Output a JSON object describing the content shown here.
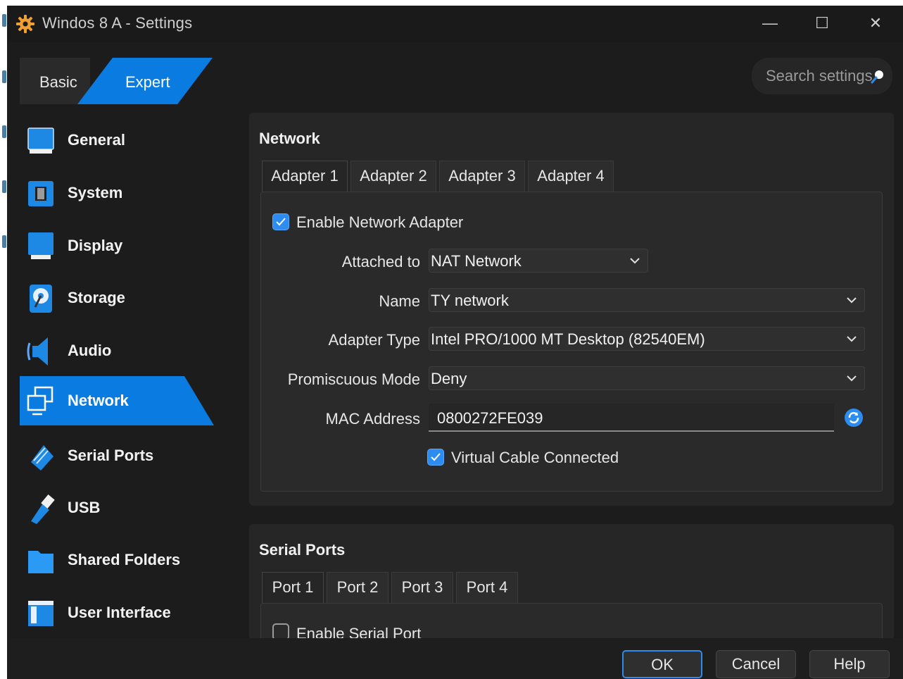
{
  "window": {
    "title": "Windos 8 A - Settings",
    "controls": {
      "minimize": "—",
      "maximize": "☐",
      "close": "✕"
    }
  },
  "mode_tabs": {
    "basic": "Basic",
    "expert": "Expert",
    "active": "Expert"
  },
  "search": {
    "placeholder": "Search settings",
    "icon": "search-icon"
  },
  "sidebar": {
    "items": [
      {
        "label": "General",
        "icon": "general-monitor-icon"
      },
      {
        "label": "System",
        "icon": "system-chip-icon"
      },
      {
        "label": "Display",
        "icon": "display-monitor-icon"
      },
      {
        "label": "Storage",
        "icon": "storage-disk-icon"
      },
      {
        "label": "Audio",
        "icon": "audio-speaker-icon"
      },
      {
        "label": "Network",
        "icon": "network-icon",
        "active": true
      },
      {
        "label": "Serial Ports",
        "icon": "serial-port-icon"
      },
      {
        "label": "USB",
        "icon": "usb-icon"
      },
      {
        "label": "Shared Folders",
        "icon": "folder-icon"
      },
      {
        "label": "User Interface",
        "icon": "user-interface-icon"
      }
    ]
  },
  "network": {
    "title": "Network",
    "tabs": [
      "Adapter 1",
      "Adapter 2",
      "Adapter 3",
      "Adapter 4"
    ],
    "active_tab": "Adapter 1",
    "enable_label": "Enable Network Adapter",
    "enable_checked": true,
    "fields": {
      "attached_to": {
        "label": "Attached to",
        "value": "NAT Network"
      },
      "name": {
        "label": "Name",
        "value": "TY network"
      },
      "adapter_type": {
        "label": "Adapter Type",
        "value": "Intel PRO/1000 MT Desktop (82540EM)"
      },
      "promiscuous": {
        "label": "Promiscuous Mode",
        "value": "Deny"
      },
      "mac": {
        "label": "MAC Address",
        "value": "0800272FE039"
      }
    },
    "cable_label": "Virtual Cable Connected",
    "cable_checked": true
  },
  "serial_ports": {
    "title": "Serial Ports",
    "tabs": [
      "Port 1",
      "Port 2",
      "Port 3",
      "Port 4"
    ],
    "active_tab": "Port 1",
    "enable_label": "Enable Serial Port",
    "enable_checked": false
  },
  "buttons": {
    "ok": "OK",
    "cancel": "Cancel",
    "help": "Help"
  },
  "colors": {
    "accent": "#0a7be0",
    "background": "#1c1c1c",
    "panel": "#262626"
  }
}
